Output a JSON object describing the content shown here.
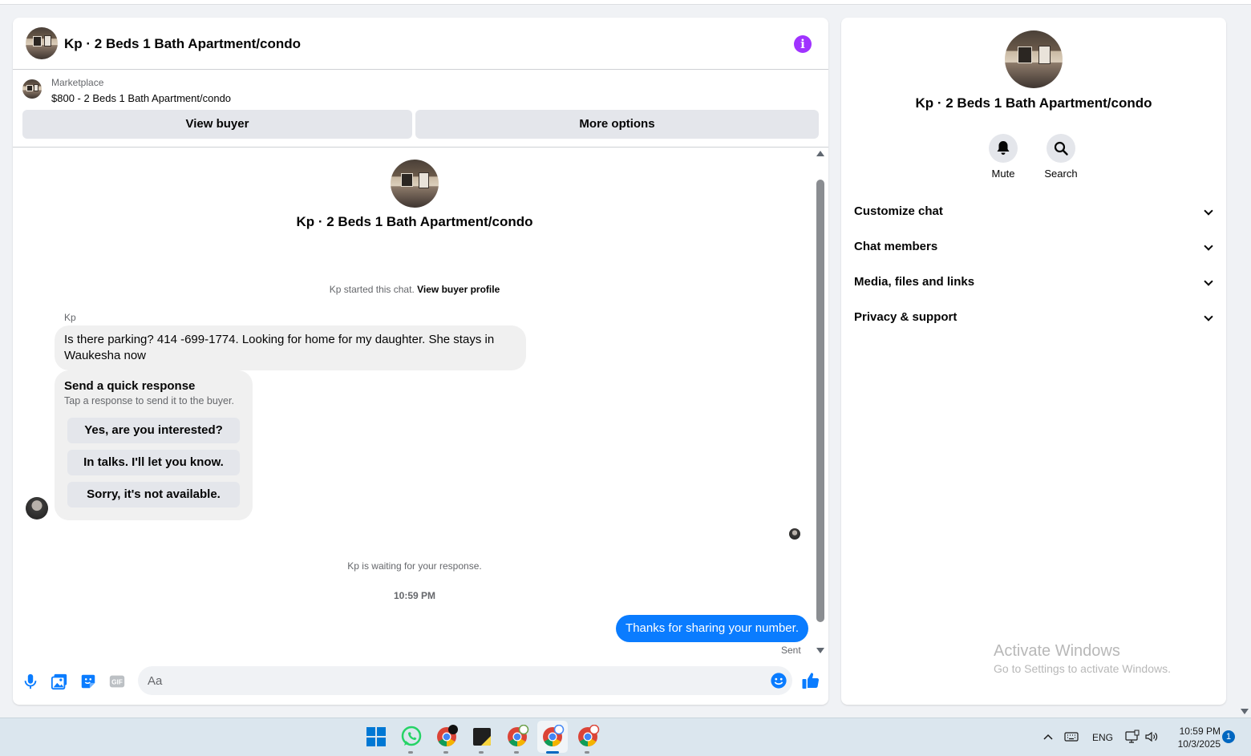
{
  "chat": {
    "header_title": "Kp · 2 Beds 1 Bath Apartment/condo",
    "marketplace_label": "Marketplace",
    "listing_title": "$800 - 2 Beds 1 Bath Apartment/condo",
    "view_buyer_label": "View buyer",
    "more_options_label": "More options",
    "center_title": "Kp · 2 Beds 1 Bath Apartment/condo",
    "started_text": "Kp started this chat.",
    "view_buyer_profile_label": "View buyer profile",
    "sender_name": "Kp",
    "incoming_message": "Is there parking? 414 -699-1774. Looking for home for my daughter. She stays in Waukesha now",
    "quick_response": {
      "title": "Send a quick response",
      "subtitle": "Tap a response to send it to the buyer.",
      "options": [
        "Yes, are you interested?",
        "In talks. I'll let you know.",
        "Sorry, it's not available."
      ]
    },
    "waiting_text": "Kp is waiting for your response.",
    "timestamp": "10:59 PM",
    "outgoing_message": "Thanks for sharing your number.",
    "sent_label": "Sent",
    "composer_placeholder": "Aa"
  },
  "details": {
    "title": "Kp · 2 Beds 1 Bath Apartment/condo",
    "mute_label": "Mute",
    "search_label": "Search",
    "sections": [
      "Customize chat",
      "Chat members",
      "Media, files and links",
      "Privacy & support"
    ]
  },
  "watermark": {
    "title": "Activate Windows",
    "subtitle": "Go to Settings to activate Windows."
  },
  "taskbar": {
    "language": "ENG",
    "time": "10:59 PM",
    "date": "10/3/2025",
    "notification_count": "1"
  },
  "colors": {
    "accent_blue": "#0a7cff",
    "info_purple": "#a033ff",
    "bubble_grey": "#f0f0f0"
  }
}
